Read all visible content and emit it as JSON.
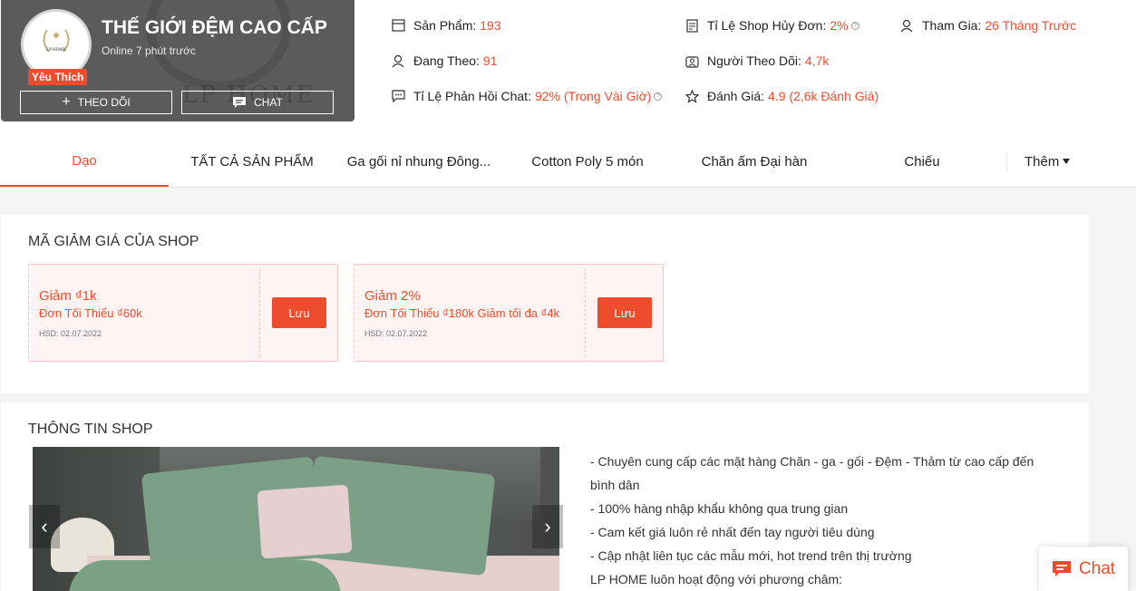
{
  "shop": {
    "name": "THẾ GIỚI ĐỆM CAO CẤP",
    "online": "Online 7 phút trước",
    "badge": "Yêu Thích",
    "follow_label": "THEO DÕI",
    "chat_label": "CHAT",
    "logo_text": "LP HOME",
    "background_logo_text": "LP HOME"
  },
  "stats": {
    "products_label": "Sản Phẩm:",
    "products_value": "193",
    "following_label": "Đang Theo:",
    "following_value": "91",
    "response_label": "Tỉ Lệ Phản Hồi Chat:",
    "response_value": "92% (Trong Vài Giờ)",
    "cancel_label": "Tỉ Lệ Shop Hủy Đơn:",
    "cancel_value": "2%",
    "followers_label": "Người Theo Dõi:",
    "followers_value": "4,7k",
    "rating_label": "Đánh Giá:",
    "rating_value": "4.9 (2,6k Đánh Giá)",
    "joined_label": "Tham Gia:",
    "joined_value": "26 Tháng Trước"
  },
  "tabs": [
    {
      "label": "Dạo",
      "active": true
    },
    {
      "label": "TẤT CẢ SẢN PHẨM"
    },
    {
      "label": "Ga gối nỉ nhung Đông..."
    },
    {
      "label": "Cotton Poly 5 món"
    },
    {
      "label": "Chăn ấm Đại hàn"
    },
    {
      "label": "Chiếu"
    }
  ],
  "more_label": "Thêm",
  "vouchers_section": {
    "title": "MÃ GIẢM GIÁ CỦA SHOP",
    "vouchers": [
      {
        "title": "Giảm ₫1k",
        "condition": "Đơn Tối Thiểu ₫60k",
        "expiry": "HSD: 02.07.2022",
        "button": "Lưu"
      },
      {
        "title": "Giảm 2%",
        "condition": "Đơn Tối Thiểu ₫180k Giảm tối đa ₫4k",
        "expiry": "HSD: 02.07.2022",
        "button": "Lưu"
      }
    ]
  },
  "shop_info": {
    "title": "THÔNG TIN SHOP",
    "lines": [
      "- Chuyên cung cấp các mặt hàng Chăn - ga - gối - Đệm - Thảm từ cao cấp đến bình dân",
      "- 100% hàng nhập khẩu không qua trung gian",
      "- Cam kết giá luôn rẻ nhất đến tay người tiêu dùng",
      "- Cập nhật liên tục các mẫu mới, hot trend trên thị trường",
      "LP HOME luôn hoạt động với phương châm:"
    ]
  },
  "chat_float": {
    "label": "Chat"
  },
  "colors": {
    "accent": "#ee4d2d",
    "card_bg": "#5b5b5b"
  }
}
